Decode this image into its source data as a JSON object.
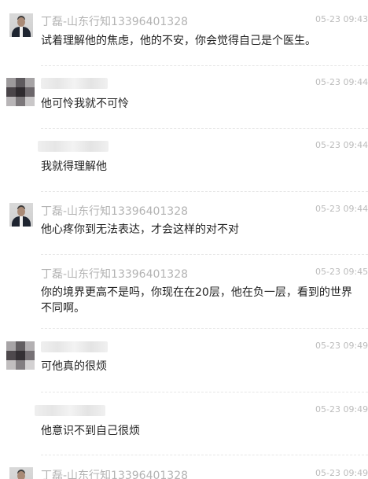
{
  "messages": [
    {
      "sender": "丁磊-山东行知13396401328",
      "time": "05-23 09:43:5",
      "text": "试着理解他的焦虑，他的不安，你会觉得自己是个医生。"
    },
    {
      "sender": "",
      "time": "05-23 09:44:3",
      "text": "他可怜我就不可怜"
    },
    {
      "sender": "",
      "time": "05-23 09:44:4",
      "text": "我就得理解他"
    },
    {
      "sender": "丁磊-山东行知13396401328",
      "time": "05-23 09:44:5",
      "text": "他心疼你到无法表达，才会这样的对不对"
    },
    {
      "sender": "丁磊-山东行知13396401328",
      "time": "05-23 09:45:3",
      "text": "你的境界更高不是吗，你现在在20层，他在负一层，看到的世界不同啊。"
    },
    {
      "sender": "",
      "time": "05-23 09:49:0",
      "text": "可他真的很烦"
    },
    {
      "sender": "",
      "time": "05-23 09:49:0",
      "text": "他意识不到自己很烦"
    },
    {
      "sender": "丁磊-山东行知13396401328",
      "time": "05-23 09:49:3",
      "text": ""
    }
  ],
  "colors": {
    "sender_name": "#b3b3b3",
    "timestamp": "#bcbcbc",
    "message_text": "#222222"
  }
}
